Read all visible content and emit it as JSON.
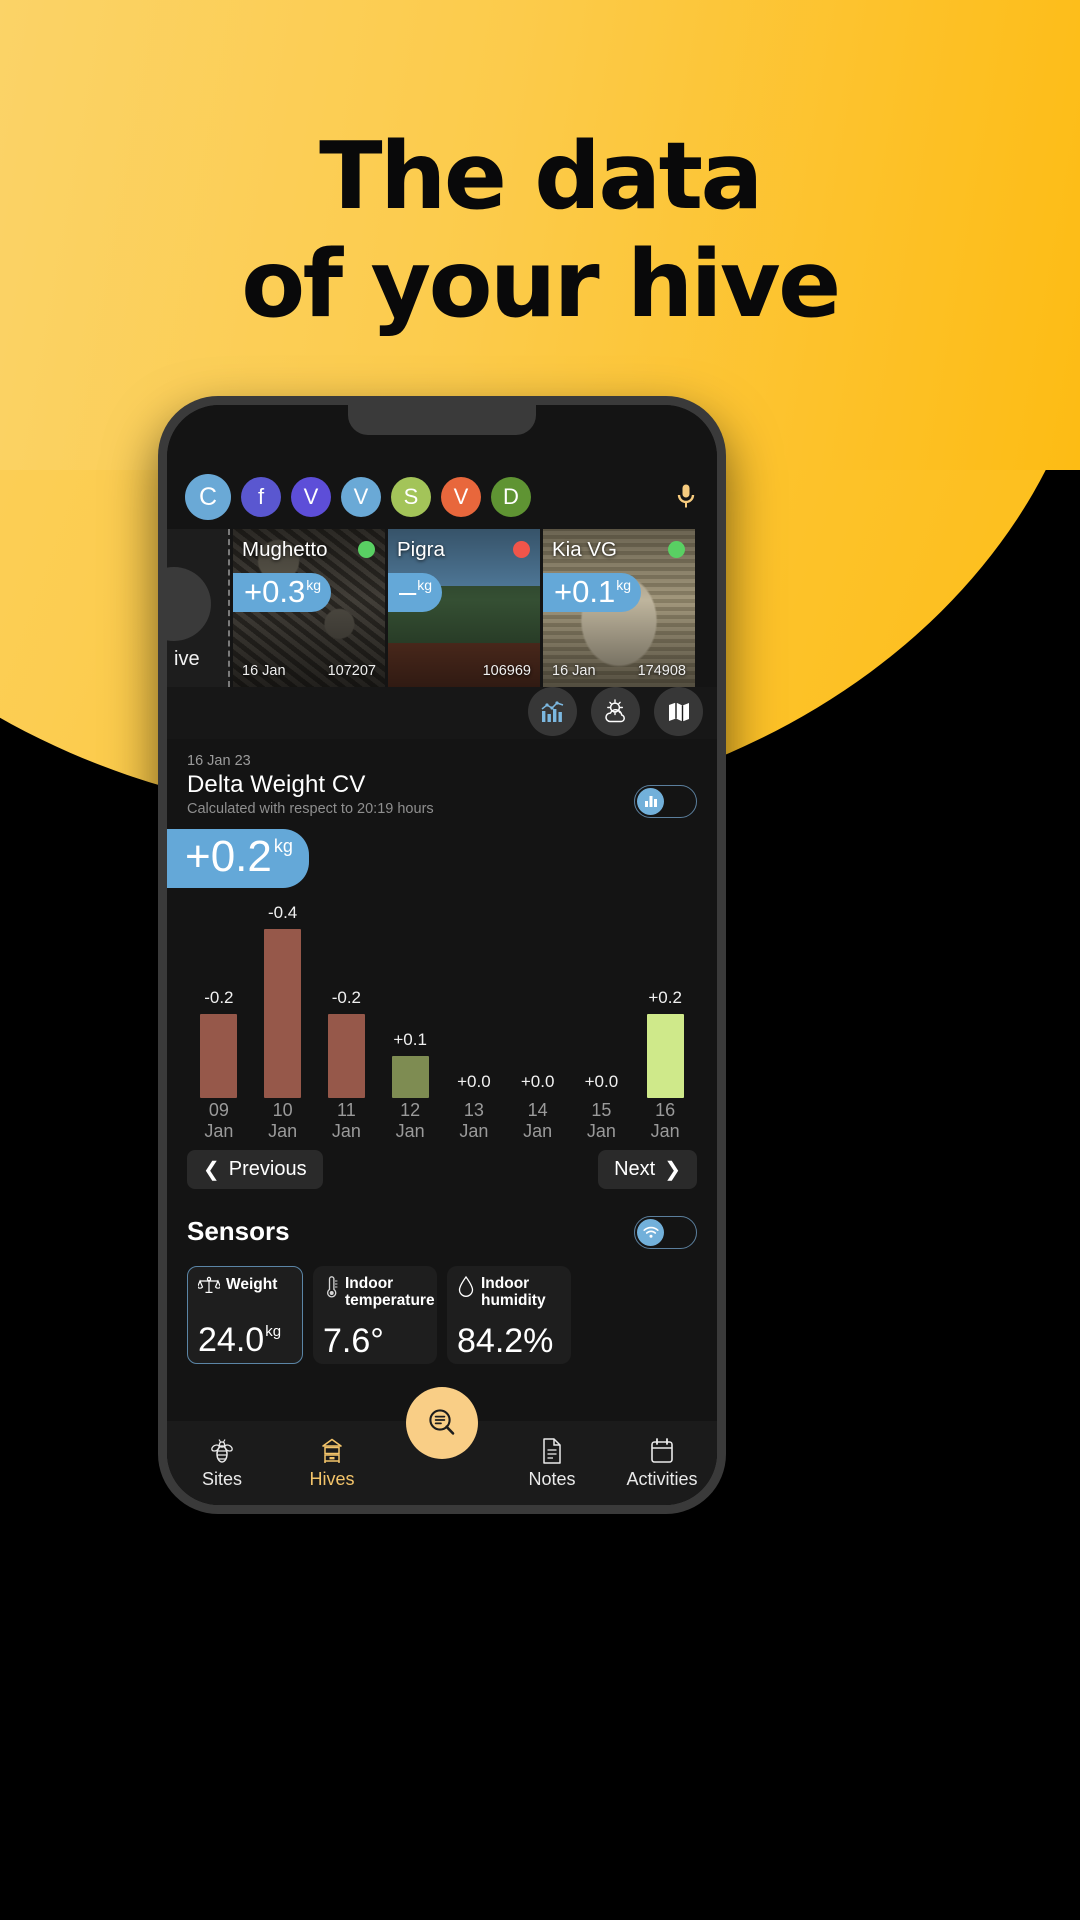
{
  "poster": {
    "headline_line1": "The data",
    "headline_line2": "of your hive",
    "bg_color_start": "#FBD367",
    "bg_color_end": "#FDBC14"
  },
  "app": {
    "accent": "#64a8d8",
    "amber": "#F9CE86",
    "avatars": [
      {
        "initial": "C",
        "color": "#6aa9d6"
      },
      {
        "initial": "f",
        "color": "#5a57d0"
      },
      {
        "initial": "V",
        "color": "#5d4ed8"
      },
      {
        "initial": "V",
        "color": "#6aa9d6"
      },
      {
        "initial": "S",
        "color": "#a3c459"
      },
      {
        "initial": "V",
        "color": "#e8673c"
      },
      {
        "initial": "D",
        "color": "#5f9433"
      }
    ],
    "mic_icon": "microphone-icon",
    "hive_peek": {
      "label": "ive"
    },
    "hives": [
      {
        "name": "Mughetto",
        "delta": "+0.3",
        "unit": "kg",
        "status_color": "#59d063",
        "date": "16 Jan",
        "id": "107207"
      },
      {
        "name": "Pigra",
        "delta": "–",
        "unit": "kg",
        "status_color": "#f0554a",
        "date": "",
        "id": "106969"
      },
      {
        "name": "Kia VG",
        "delta": "+0.1",
        "unit": "kg",
        "status_color": "#59d063",
        "date": "16 Jan",
        "id": "174908"
      }
    ],
    "round_buttons": [
      {
        "icon": "bar-chart-icon",
        "name": "statistics-button"
      },
      {
        "icon": "weather-icon",
        "name": "weather-button"
      },
      {
        "icon": "map-icon",
        "name": "map-button"
      }
    ],
    "delta_weight": {
      "date": "16 Jan 23",
      "title": "Delta Weight CV",
      "subtitle": "Calculated with respect to 20:19 hours",
      "value": "+0.2",
      "unit": "kg",
      "toggle_icon": "bar-chart-icon"
    },
    "pager": {
      "previous": "Previous",
      "next": "Next"
    },
    "sensors": {
      "title": "Sensors",
      "toggle_icon": "wifi-icon",
      "cards": [
        {
          "icon": "scale-icon",
          "label": "Weight",
          "value": "24.0",
          "unit": "kg",
          "selected": true
        },
        {
          "icon": "thermometer-icon",
          "label": "Indoor temperature",
          "value": "7.6°",
          "unit": "",
          "selected": false
        },
        {
          "icon": "droplet-icon",
          "label": "Indoor humidity",
          "value": "84.2%",
          "unit": "",
          "selected": false
        }
      ]
    },
    "bottom_nav": [
      {
        "label": "Sites",
        "icon": "bee-icon",
        "active": false
      },
      {
        "label": "Hives",
        "icon": "hive-icon",
        "active": true
      },
      {
        "label": "Notes",
        "icon": "document-icon",
        "active": false
      },
      {
        "label": "Activities",
        "icon": "calendar-icon",
        "active": false
      }
    ],
    "fab": {
      "icon": "search-list-icon"
    }
  },
  "chart_data": {
    "type": "bar",
    "title": "Delta Weight CV",
    "xlabel": "",
    "ylabel": "kg",
    "categories": [
      "09 Jan",
      "10 Jan",
      "11 Jan",
      "12 Jan",
      "13 Jan",
      "14 Jan",
      "15 Jan",
      "16 Jan"
    ],
    "day_numbers": [
      "09",
      "10",
      "11",
      "12",
      "13",
      "14",
      "15",
      "16"
    ],
    "month_labels": [
      "Jan",
      "Jan",
      "Jan",
      "Jan",
      "Jan",
      "Jan",
      "Jan",
      "Jan"
    ],
    "values": [
      -0.2,
      -0.4,
      -0.2,
      0.1,
      0.0,
      0.0,
      0.0,
      0.2
    ],
    "value_labels": [
      "-0.2",
      "-0.4",
      "-0.2",
      "+0.1",
      "+0.0",
      "+0.0",
      "+0.0",
      "+0.2"
    ],
    "bar_colors": [
      "#96584a",
      "#96584a",
      "#96584a",
      "#7e8c52",
      "none",
      "none",
      "none",
      "#cfe98a"
    ],
    "ylim": [
      -0.45,
      0.25
    ],
    "grid": false,
    "legend": "none"
  }
}
